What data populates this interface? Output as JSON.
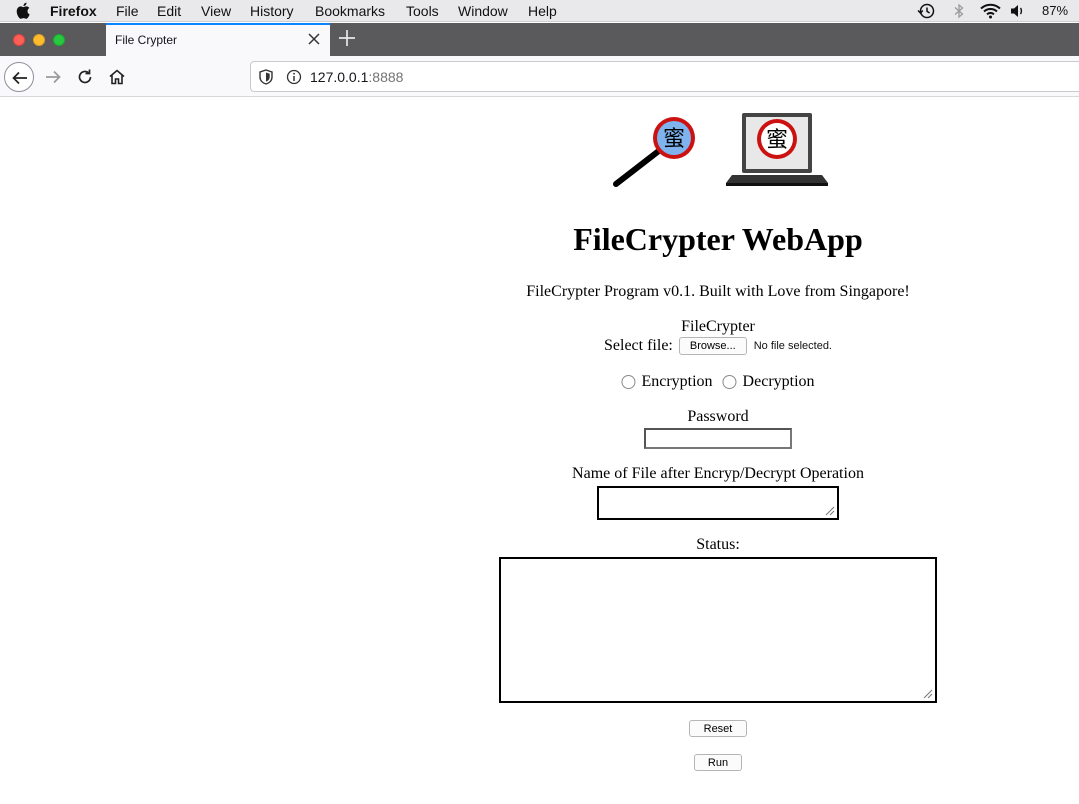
{
  "menubar": {
    "app_name": "Firefox",
    "items": [
      "File",
      "Edit",
      "View",
      "History",
      "Bookmarks",
      "Tools",
      "Window",
      "Help"
    ],
    "battery": "87%"
  },
  "browser": {
    "tab_title": "File Crypter",
    "url_host": "127.0.0.1",
    "url_port": ":8888"
  },
  "page": {
    "logo_glyph": "蜜",
    "title": "FileCrypter WebApp",
    "subtitle": "FileCrypter Program v0.1. Built with Love from Singapore!",
    "section_label": "FileCrypter",
    "select_file_label": "Select file:",
    "browse_label": "Browse...",
    "file_status": "No file selected.",
    "radio_encryption": "Encryption",
    "radio_decryption": "Decryption",
    "password_label": "Password",
    "password_value": "",
    "output_name_label": "Name of File after Encryp/Decrypt Operation",
    "output_name_value": "",
    "status_label": "Status:",
    "status_value": "",
    "reset_label": "Reset",
    "run_label": "Run"
  }
}
